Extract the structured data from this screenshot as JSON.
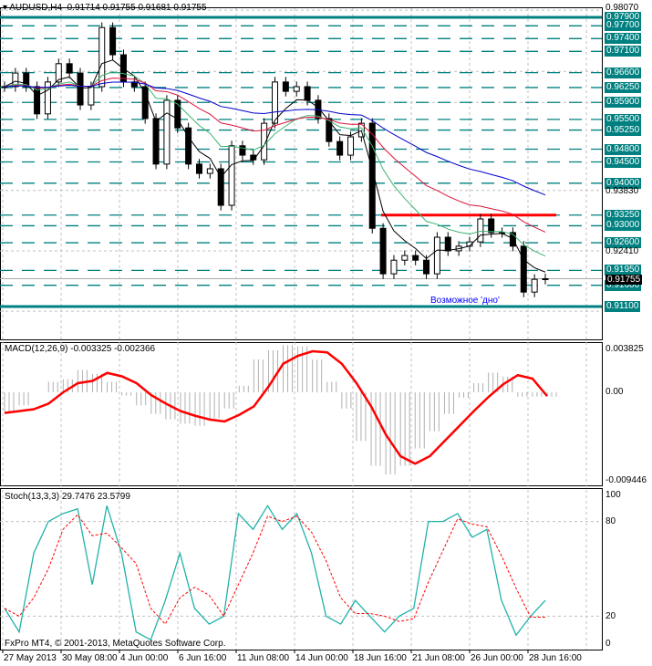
{
  "header": {
    "symbol": "AUDUSD,H4",
    "ohlc": "0.91714 0.91755 0.91681 0.91755"
  },
  "price_axis": {
    "labels": [
      "0.98070",
      "0.93830",
      "0.92410"
    ],
    "current": "0.91755",
    "current_value": 0.91755
  },
  "levels": [
    {
      "label": "0.97900",
      "value": 0.979,
      "style": "solid"
    },
    {
      "label": "0.97700",
      "value": 0.977,
      "style": "dash"
    },
    {
      "label": "0.97400",
      "value": 0.974,
      "style": "dash"
    },
    {
      "label": "0.97100",
      "value": 0.971,
      "style": "dash"
    },
    {
      "label": "0.96600",
      "value": 0.966,
      "style": "dash"
    },
    {
      "label": "0.96250",
      "value": 0.9625,
      "style": "dash"
    },
    {
      "label": "0.95900",
      "value": 0.959,
      "style": "dash"
    },
    {
      "label": "0.95500",
      "value": 0.955,
      "style": "dash"
    },
    {
      "label": "0.95250",
      "value": 0.9525,
      "style": "dash"
    },
    {
      "label": "0.94800",
      "value": 0.948,
      "style": "dash"
    },
    {
      "label": "0.94500",
      "value": 0.945,
      "style": "dash"
    },
    {
      "label": "0.94000",
      "value": 0.94,
      "style": "dash"
    },
    {
      "label": "0.93250",
      "value": 0.9325,
      "style": "dash"
    },
    {
      "label": "0.93000",
      "value": 0.93,
      "style": "dash"
    },
    {
      "label": "0.92600",
      "value": 0.926,
      "style": "dash"
    },
    {
      "label": "0.91950",
      "value": 0.9195,
      "style": "dash"
    },
    {
      "label": "0.91600",
      "value": 0.916,
      "style": "dash"
    },
    {
      "label": "0.91100",
      "value": 0.911,
      "style": "solid"
    }
  ],
  "resistance": {
    "value": 0.9325,
    "color": "#ff0000"
  },
  "annotation": "Возможное 'дно'",
  "macd": {
    "title": "MACD(12,26,9) -0.003325 -0.002366",
    "axis_top": "0.003825",
    "axis_zero": "0.00",
    "axis_bottom": "-0.009446"
  },
  "stoch": {
    "title": "Stoch(13,3,3) 29.7476 23.5799",
    "axis": [
      "100",
      "80",
      "20",
      "0"
    ]
  },
  "footer": "FxPro MT4, © 2001-2013, MetaQuotes Software Corp.",
  "dates": [
    "27 May 2013",
    "30 May 08:00",
    "4 Jun 00:00",
    "6 Jun 16:00",
    "11 Jun 08:00",
    "14 Jun 00:00",
    "18 Jun 16:00",
    "21 Jun 08:00",
    "26 Jun 00:00",
    "28 Jun 16:00"
  ],
  "colors": {
    "level": "#008080",
    "signal": "#ff0000",
    "stoch_main": "#20b2aa",
    "ma_slow": "#0000cd",
    "ma_mid": "#dc143c",
    "ma_fast": "#3cb371",
    "ma_short": "#000000"
  },
  "chart_data": {
    "type": "candlestick",
    "closes": [
      0.9627,
      0.9659,
      0.9627,
      0.9563,
      0.9638,
      0.9681,
      0.9659,
      0.9584,
      0.9627,
      0.9766,
      0.9702,
      0.9638,
      0.9627,
      0.9552,
      0.9445,
      0.9595,
      0.953,
      0.9445,
      0.9423,
      0.9434,
      0.9348,
      0.9488,
      0.9466,
      0.9455,
      0.9541,
      0.9638,
      0.9616,
      0.9627,
      0.9595,
      0.9552,
      0.9498,
      0.9466,
      0.9509,
      0.9541,
      0.9294,
      0.9187,
      0.9219,
      0.923,
      0.9219,
      0.9187,
      0.9273,
      0.9241,
      0.9252,
      0.9262,
      0.9316,
      0.9284,
      0.9284,
      0.9252,
      0.9144,
      0.9174,
      0.91755
    ],
    "ylim": [
      0.9099,
      0.9807
    ],
    "macd_signal": [
      -0.0022,
      -0.002,
      -0.0018,
      -0.0012,
      0.0,
      0.0008,
      0.001,
      0.0017,
      0.0014,
      0.0008,
      -0.0003,
      -0.0012,
      -0.002,
      -0.0025,
      -0.0029,
      -0.0031,
      -0.0024,
      -0.0015,
      0.0005,
      0.0025,
      0.0032,
      0.0036,
      0.0035,
      0.0025,
      0.0008,
      -0.0015,
      -0.0045,
      -0.0068,
      -0.0076,
      -0.0068,
      -0.0052,
      -0.0036,
      -0.002,
      -0.0005,
      0.0007,
      0.0015,
      0.0012,
      -0.0004
    ],
    "macd_ylim": [
      -0.009446,
      0.003825
    ],
    "stoch_main": [
      25,
      10,
      60,
      80,
      85,
      88,
      40,
      90,
      60,
      10,
      5,
      30,
      60,
      25,
      15,
      20,
      85,
      75,
      90,
      75,
      85,
      60,
      20,
      15,
      30,
      20,
      10,
      20,
      25,
      80,
      80,
      85,
      70,
      75,
      30,
      8,
      20,
      30
    ],
    "stoch_ylim": [
      0,
      100
    ]
  }
}
